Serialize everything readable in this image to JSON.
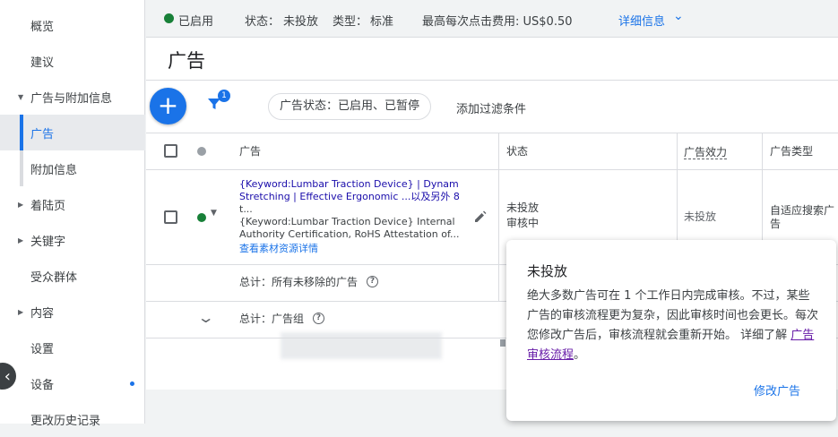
{
  "sidebar": {
    "items": [
      {
        "label": "概览"
      },
      {
        "label": "建议"
      },
      {
        "label": "广告与附加信息"
      },
      {
        "label": "广告"
      },
      {
        "label": "附加信息"
      },
      {
        "label": "着陆页"
      },
      {
        "label": "关键字"
      },
      {
        "label": "受众群体"
      },
      {
        "label": "内容"
      },
      {
        "label": "设置"
      },
      {
        "label": "设备"
      },
      {
        "label": "更改历史记录"
      }
    ],
    "collapse_icon": "chevron-left-icon"
  },
  "topbar": {
    "status": "已启用",
    "state_label": "状态：",
    "state_value": "未投放",
    "type_label": "类型：",
    "type_value": "标准",
    "max_cpc": "最高每次点击费用: US$0.50",
    "details_link": "详细信息",
    "status_color": "#188038"
  },
  "page": {
    "title": "广告"
  },
  "toolbar": {
    "add_icon": "+",
    "filter_count": "1",
    "filter_chip": "广告状态：已启用、已暂停",
    "add_filter": "添加过滤条件"
  },
  "table": {
    "headers": {
      "ad": "广告",
      "status": "状态",
      "effectiveness": "广告效力",
      "ad_type": "广告类型"
    },
    "row": {
      "line1": "{Keyword:Lumbar Traction Device} | Dynamic",
      "line2": "Stretching | Effective Ergonomic ...以及另外 8 项",
      "line3": "t...",
      "line4": "{Keyword:Lumbar Traction Device} Internal",
      "line5": "Authority Certification, RoHS Attestation of...",
      "link": "查看素材资源详情",
      "status_line1": "未投放",
      "status_line2": "审核中",
      "effectiveness": "未投放",
      "ad_type": "自适应搜索广告"
    },
    "total_all": "总计：所有未移除的广告",
    "total_group": "总计：广告组"
  },
  "popup": {
    "title": "未投放",
    "body": "绝大多数广告可在 1 个工作日内完成审核。不过，某些广告的审核流程更为复杂，因此审核时间也会更长。每次您修改广告后，审核流程就会重新开始。 详细了解 ",
    "link": "广告审核流程",
    "body_end": "。",
    "button": "修改广告"
  }
}
